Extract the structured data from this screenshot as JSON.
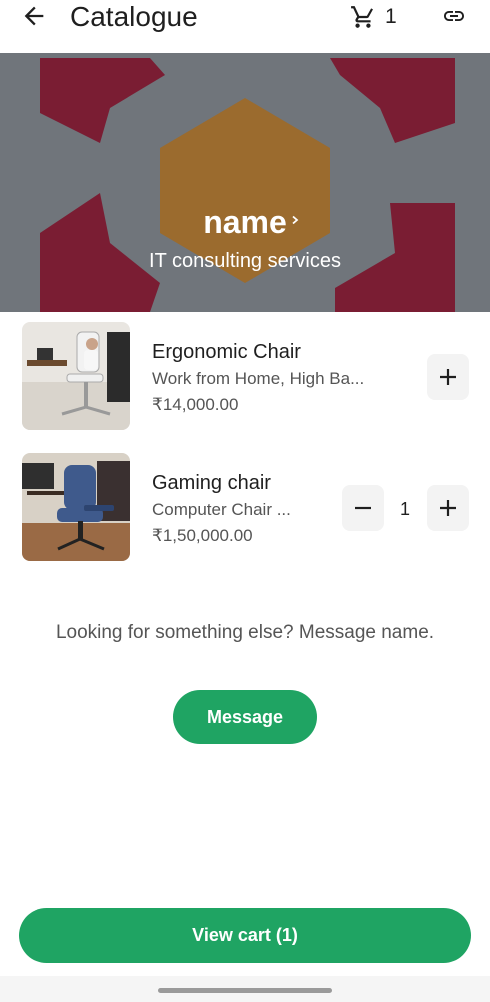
{
  "header": {
    "title": "Catalogue",
    "cart_count": "1",
    "icons": [
      "back-arrow-icon",
      "cart-icon",
      "link-icon"
    ]
  },
  "hero": {
    "name": "name",
    "subtitle": "IT consulting services",
    "colors": {
      "background": "#6f747a",
      "hexagon": "#a07030",
      "accent": "#7a1d33"
    }
  },
  "products": [
    {
      "name": "Ergonomic Chair",
      "description": "Work from Home, High Ba...",
      "price": "₹14,000.00",
      "in_cart": false
    },
    {
      "name": "Gaming chair",
      "description": "Computer Chair ...",
      "price": "₹1,50,000.00",
      "in_cart": true,
      "quantity": "1"
    }
  ],
  "prompt": "Looking for something else? Message name.",
  "message_button": "Message",
  "view_cart_button": "View cart (1)",
  "colors": {
    "primary": "#1fa463"
  }
}
